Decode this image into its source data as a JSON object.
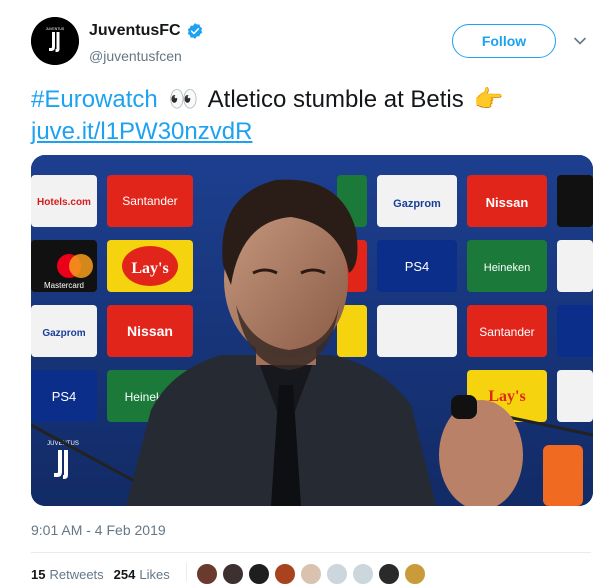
{
  "account": {
    "display_name": "JuventusFC",
    "handle": "@juventusfcen",
    "verified": true,
    "avatar_icon": "juventus-logo-icon"
  },
  "follow_button": {
    "label": "Follow"
  },
  "menu_icon": "chevron-down-icon",
  "tweet": {
    "hashtag": "#Eurowatch",
    "eyes_emoji": "👀",
    "headline": "Atletico stumble at Betis",
    "point_emoji": "👉",
    "link": "juve.it/l1PW30nzvdR",
    "photo_description": "Press conference photo",
    "backdrop_sponsors": [
      "Hotels.com",
      "Santander",
      "Mastercard",
      "Lay's",
      "Nissan",
      "Gazprom",
      "PS4",
      "Heineken"
    ],
    "photo_logo_text": "JUVENTUS"
  },
  "timestamp": "9:01 AM - 4 Feb 2019",
  "stats": {
    "retweets_count": "15",
    "retweets_label": "Retweets",
    "likes_count": "254",
    "likes_label": "Likes"
  },
  "colors": {
    "accent": "#1da1f2",
    "text": "#14171a",
    "muted": "#657786"
  }
}
